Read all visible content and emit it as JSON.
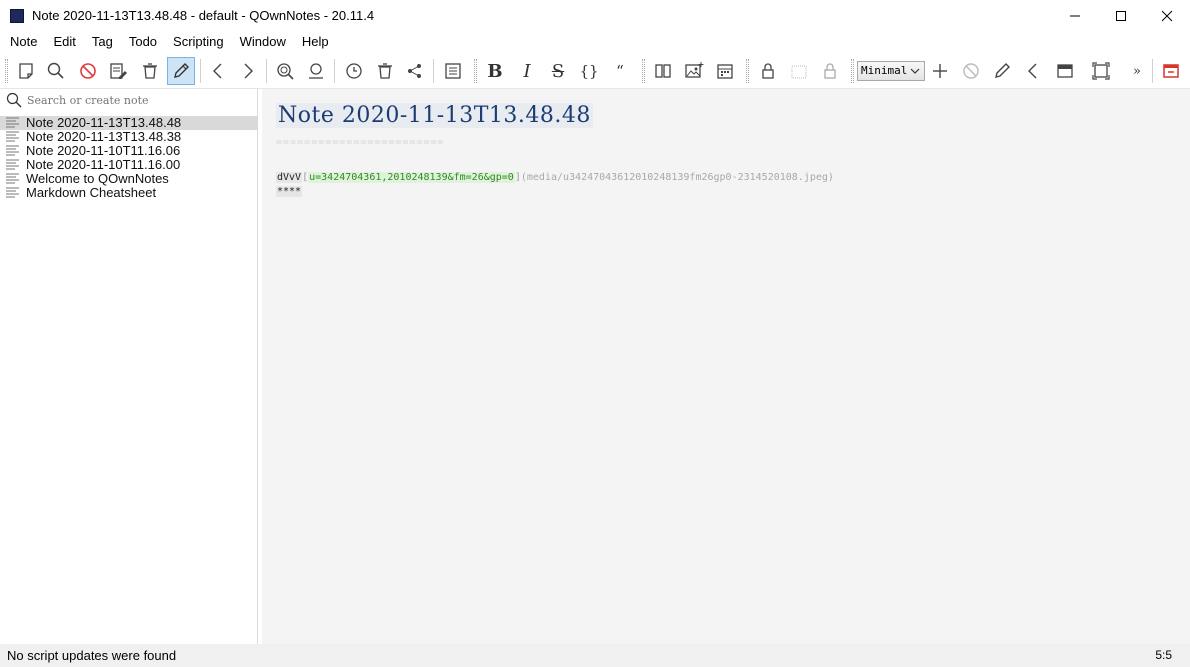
{
  "window": {
    "title": "Note 2020-11-13T13.48.48 - default - QOwnNotes - 20.11.4"
  },
  "menu": [
    "Note",
    "Edit",
    "Tag",
    "Todo",
    "Scripting",
    "Window",
    "Help"
  ],
  "toolbar": {
    "workspace_combo": "Minimal"
  },
  "search": {
    "placeholder": "Search or create note"
  },
  "notes": [
    "Note 2020-11-13T13.48.48",
    "Note 2020-11-13T13.48.38",
    "Note 2020-11-10T11.16.06",
    "Note 2020-11-10T11.16.00",
    "Welcome to QOwnNotes",
    "Markdown Cheatsheet"
  ],
  "editor": {
    "heading": "Note 2020-11-13T13.48.48",
    "heading_underline": "========================",
    "line1_prefix": "dVvV",
    "line1_bracket_open": "[",
    "line1_link_text": "u=3424704361,2010248139&fm=26&gp=0",
    "line1_bracket_close": "]",
    "line1_path": "(media/u34247043612010248139fm26gp0-2314520108.jpeg)",
    "line2": "****"
  },
  "status": {
    "message": "No script updates were found",
    "cursor": "5:5"
  }
}
